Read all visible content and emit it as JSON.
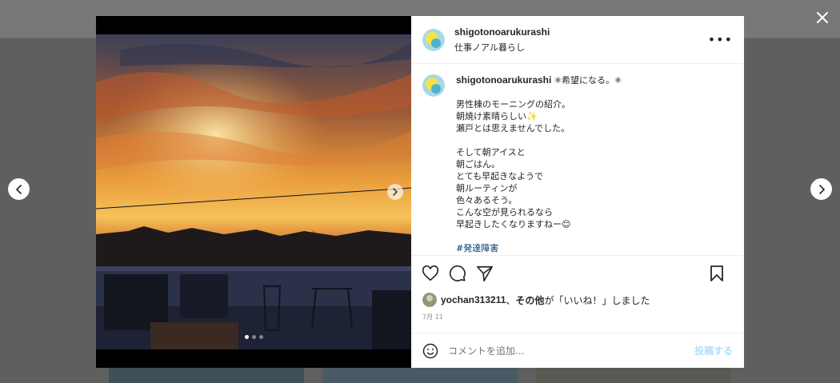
{
  "post": {
    "username": "shigotonoarukurashi",
    "subtitle": "仕事ノアル暮らし",
    "caption_title": "✳︎希望になる。✳︎",
    "caption_lines": [
      "",
      "男性棟のモーニングの紹介。",
      "朝焼け素晴らしい✨",
      "瀬戸とは思えませんでした。",
      "",
      "そして朝アイスと",
      "朝ごはん。",
      "とても早起きなようで",
      "朝ルーティンが",
      "色々あるそう。",
      "こんな空が見られるなら",
      "早起きしたくなりますねー😊",
      ""
    ],
    "hashtag": "#発達障害",
    "likes": {
      "user": "yochan313211",
      "sep": "、",
      "others": "その他",
      "suffix": "が「いいね！」しました"
    },
    "date": "7月 11",
    "comment_placeholder": "コメントを追加...",
    "post_button": "投稿する"
  },
  "media": {
    "image_count": 3,
    "active_index": 0
  },
  "icons": {
    "close": "close-icon",
    "prev": "chevron-left-icon",
    "next": "chevron-right-icon",
    "like": "heart-icon",
    "comment": "comment-icon",
    "share": "send-icon",
    "save": "bookmark-icon",
    "more": "more-icon",
    "emoji": "emoji-icon"
  },
  "colors": {
    "link": "#00376b",
    "post_button": "#b2dffc",
    "meta": "#8e8e8e"
  }
}
